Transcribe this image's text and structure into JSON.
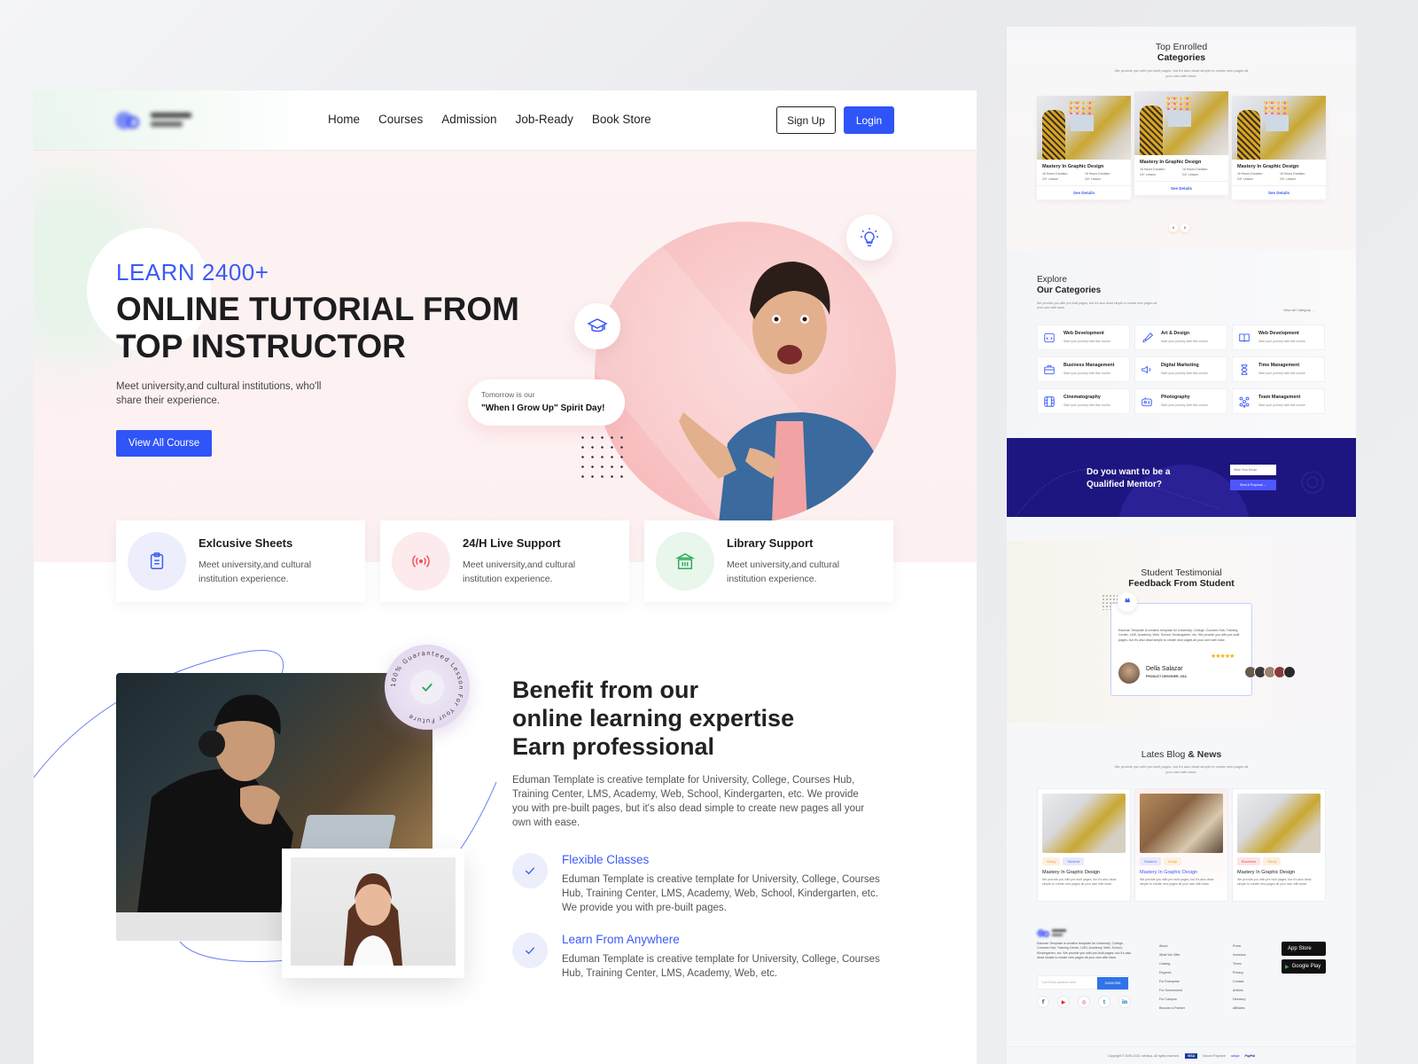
{
  "header": {
    "logo_alt": "Business School",
    "nav": [
      "Home",
      "Courses",
      "Admission",
      "Job-Ready",
      "Book Store"
    ],
    "signup_label": "Sign Up",
    "login_label": "Login"
  },
  "hero": {
    "eyebrow": "LEARN 2400+",
    "title": "ONLINE TUTORIAL FROM TOP INSTRUCTOR",
    "description": "Meet university,and cultural institutions, who'll share their experience.",
    "cta_label": "View All Course",
    "speech_line1": "Tomorrow is our",
    "speech_line2": "\"When I Grow Up\" Spirit Day!",
    "icons": [
      "graduation-cap-icon",
      "lightbulb-icon"
    ]
  },
  "features": [
    {
      "title": "Exlcusive Sheets",
      "desc": "Meet university,and cultural institution experience.",
      "icon": "clipboard-icon",
      "color": "#3b5bf5",
      "bg": "#eceefc"
    },
    {
      "title": "24/H Live Support",
      "desc": "Meet university,and cultural institution experience.",
      "icon": "broadcast-icon",
      "color": "#f0505a",
      "bg": "#fdeaec"
    },
    {
      "title": "Library Support",
      "desc": "Meet university,and cultural institution experience.",
      "icon": "library-icon",
      "color": "#2eaa5c",
      "bg": "#e8f6ec"
    }
  ],
  "benefit": {
    "badge_text": "100% Guaranteed Lesson For Your Future",
    "title_lines": [
      "Benefit from our",
      "online learning expertise",
      "Earn professional"
    ],
    "description": "Eduman Template is creative template for University, College, Courses Hub, Training Center, LMS, Academy, Web, School, Kindergarten, etc. We provide you with pre-built pages, but it's also dead simple to create new pages all your own with ease.",
    "items": [
      {
        "title": "Flexible Classes",
        "desc": "Eduman Template is creative template for University, College, Courses Hub, Training Center, LMS, Academy, Web, School, Kindergarten, etc. We provide you with pre-built pages."
      },
      {
        "title": "Learn From Anywhere",
        "desc": "Eduman Template is creative template for University, College, Courses Hub, Training Center, LMS, Academy, Web, etc."
      }
    ]
  },
  "top_enrolled": {
    "title_line1": "Top Enrolled",
    "title_line2": "Categories",
    "subtitle": "We provide you with pre-built pages, but it's also dead simple to create new pages all your own with ease.",
    "cards": [
      {
        "title": "Mastery In Graphic Design",
        "meta": [
          "16 Hours Duration",
          "16 Hours Duration",
          "24+ Lesson",
          "24+ Lesson"
        ],
        "button": "See Details"
      },
      {
        "title": "Mastery In Graphic Design",
        "meta": [
          "16 Hours Duration",
          "16 Hours Duration",
          "24+ Lesson",
          "24+ Lesson"
        ],
        "button": "See Details"
      },
      {
        "title": "Mastery In Graphic Design",
        "meta": [
          "16 Hours Duration",
          "16 Hours Duration",
          "24+ Lesson",
          "24+ Lesson"
        ],
        "button": "See Details"
      }
    ],
    "prev": "‹",
    "next": "›"
  },
  "categories": {
    "title_line1": "Explore",
    "title_line2": "Our Categories",
    "subtitle": "We provide you with pre-built pages, but it's also dead simple to create new pages all your own with ease.",
    "view_all": "View all Category →",
    "items": [
      {
        "name": "Web Development",
        "sub": "Start your journey with this course.",
        "icon": "code-window-icon"
      },
      {
        "name": "Art & Design",
        "sub": "Start your journey with this course.",
        "icon": "brush-icon"
      },
      {
        "name": "Web Development",
        "sub": "Start your journey with this course.",
        "icon": "book-open-icon"
      },
      {
        "name": "Business Management",
        "sub": "Start your journey with this course.",
        "icon": "briefcase-icon"
      },
      {
        "name": "Digital Marketing",
        "sub": "Start your journey with this course.",
        "icon": "megaphone-icon"
      },
      {
        "name": "Time Management",
        "sub": "Start your journey with this course.",
        "icon": "hourglass-icon"
      },
      {
        "name": "Cinematography",
        "sub": "Start your journey with this course.",
        "icon": "film-icon"
      },
      {
        "name": "Photography",
        "sub": "Start your journey with this course.",
        "icon": "camera-icon"
      },
      {
        "name": "Team Management",
        "sub": "Start your journey with this course.",
        "icon": "team-icon"
      }
    ]
  },
  "mentor": {
    "title": "Do you want to be a Qualified Mentor?",
    "email_placeholder": "Write Your Email",
    "button": "Send A Proposal →"
  },
  "testimonial": {
    "title_line1": "Student Testimonial",
    "title_line2": "Feedback From Student",
    "text": "Eduman Template is creative template for University, College, Courses Hub, Training Center, LMS, Academy, Web, School, Kindergarten, etc. We provide you with pre-built pages, but it's also dead simple to create new pages all your own with ease.",
    "rating": 4.5,
    "stars": "★★★★★",
    "name": "Della Salazar",
    "role": "PRODUCT DESIGNER, USA"
  },
  "blog": {
    "title_light": "Lates Blog",
    "title_bold": "& News",
    "subtitle": "We provide you with pre-built pages, but it's also dead simple to create new pages all your own with ease.",
    "posts": [
      {
        "tags": [
          "Study",
          "Student"
        ],
        "title": "Mastery In Graphic Design",
        "desc": "We provide you with pre built pages, but it's also dead simple to create new pages all your own with ease."
      },
      {
        "tags": [
          "Student",
          "Study"
        ],
        "title": "Mastery In Graphic Design",
        "desc": "We provide you with pre built pages, but it's also dead simple to create new pages all your own with ease."
      },
      {
        "tags": [
          "Business",
          "Study"
        ],
        "title": "Mastery In Graphic Design",
        "desc": "We provide you with pre built pages, but it's also dead simple to create new pages all your own with ease."
      }
    ]
  },
  "footer": {
    "description": "Eduman Template is creative template for University, College, Courses Hub, Training Center, LMS, Academy, Web, School, Kindergarten, etc. We provide you with pre-built pages, but it's also dead simple to create new pages all your own with ease.",
    "email_placeholder": "Your Email address Here",
    "subscribe": "SUBSCRIB",
    "social": [
      "f",
      "▶",
      "◎",
      "t",
      "in"
    ],
    "col1": [
      "About",
      "What We Offer",
      "Catalog",
      "Degrees",
      "For Enterprise",
      "For Government",
      "For Campus",
      "Become a Partner"
    ],
    "col2": [
      "Press",
      "Investors",
      "Terms",
      "Privacy",
      "Contact",
      "Articles",
      "Directory",
      "Affiliates"
    ],
    "app_store": "App Store",
    "google_play": "Google Play",
    "copyright": "Copyright © 2009-2023, Infinitus. All rights reserved.",
    "payments": [
      "VISA",
      "Secure Payment",
      "stripe",
      "PayPal"
    ]
  }
}
